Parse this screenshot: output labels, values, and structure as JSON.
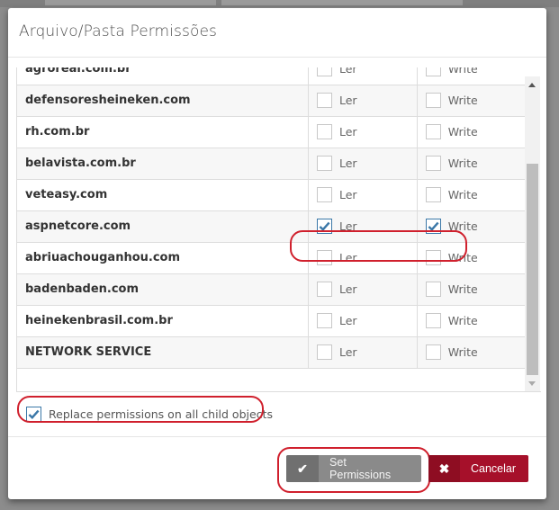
{
  "modal": {
    "title": "Arquivo/Pasta Permissões"
  },
  "permissions": {
    "read_label": "Ler",
    "write_label": "Write",
    "rows": [
      {
        "user": "agroreal.com.br",
        "read": false,
        "write": false
      },
      {
        "user": "defensoresheineken.com",
        "read": false,
        "write": false
      },
      {
        "user": "rh.com.br",
        "read": false,
        "write": false
      },
      {
        "user": "belavista.com.br",
        "read": false,
        "write": false
      },
      {
        "user": "veteasy.com",
        "read": false,
        "write": false
      },
      {
        "user": "aspnetcore.com",
        "read": true,
        "write": true
      },
      {
        "user": "abriuachouganhou.com",
        "read": false,
        "write": false
      },
      {
        "user": "badenbaden.com",
        "read": false,
        "write": false
      },
      {
        "user": "heinekenbrasil.com.br",
        "read": false,
        "write": false
      },
      {
        "user": "NETWORK SERVICE",
        "read": false,
        "write": false
      }
    ]
  },
  "replace_children": {
    "label": "Replace permissions on all child objects",
    "checked": true
  },
  "footer": {
    "set_permissions_label": "Set Permissions",
    "set_permissions_icon": "check-icon",
    "cancel_label": "Cancelar",
    "cancel_icon": "times-icon"
  },
  "colors": {
    "checkbox_accent": "#3b78a8",
    "cancel_button": "#a6102a",
    "set_button": "#8a8a8a",
    "annotation": "#d0202d"
  }
}
